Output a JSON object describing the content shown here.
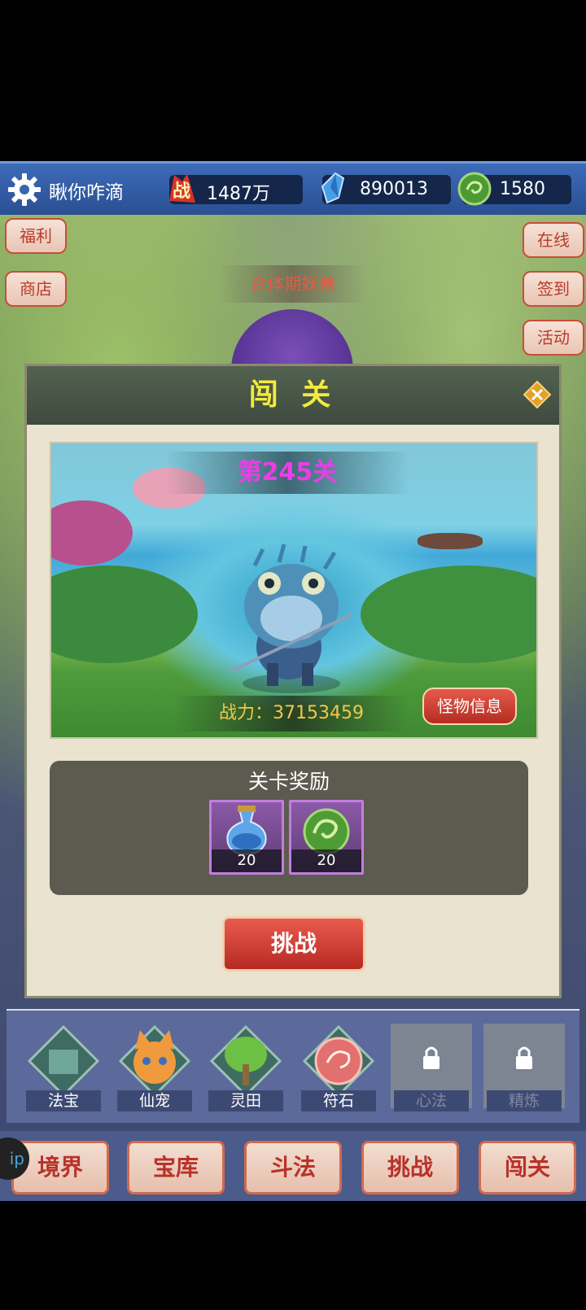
{
  "player": {
    "name": "瞅你咋滴"
  },
  "resources": [
    {
      "icon": "battle-power-icon",
      "value": "1487万"
    },
    {
      "icon": "blue-crystal-icon",
      "value": "890013"
    },
    {
      "icon": "jade-coin-icon",
      "value": "1580"
    }
  ],
  "side_buttons": {
    "left": [
      "福利",
      "商店"
    ],
    "right": [
      "在线",
      "签到",
      "活动"
    ]
  },
  "boss_label": "合体期妖兽",
  "dialog": {
    "title": "闯 关",
    "stage_number": "第245关",
    "power": "战力：37153459",
    "monster_info": "怪物信息",
    "reward_title": "关卡奖励",
    "rewards": [
      {
        "icon": "blue-potion-icon",
        "qty": "20"
      },
      {
        "icon": "green-jade-icon",
        "qty": "20"
      }
    ],
    "challenge": "挑战"
  },
  "functions": [
    {
      "label": "法宝",
      "icon": "treasure-icon",
      "locked": false
    },
    {
      "label": "仙宠",
      "icon": "fox-pet-icon",
      "locked": false
    },
    {
      "label": "灵田",
      "icon": "herb-field-icon",
      "locked": false
    },
    {
      "label": "符石",
      "icon": "rune-stone-icon",
      "locked": false
    },
    {
      "label": "心法",
      "icon": "lock-icon",
      "locked": true
    },
    {
      "label": "精炼",
      "icon": "lock-icon",
      "locked": true
    }
  ],
  "bottom_nav": [
    "境界",
    "宝库",
    "斗法",
    "挑战",
    "闯关"
  ],
  "vip_badge": "ip"
}
